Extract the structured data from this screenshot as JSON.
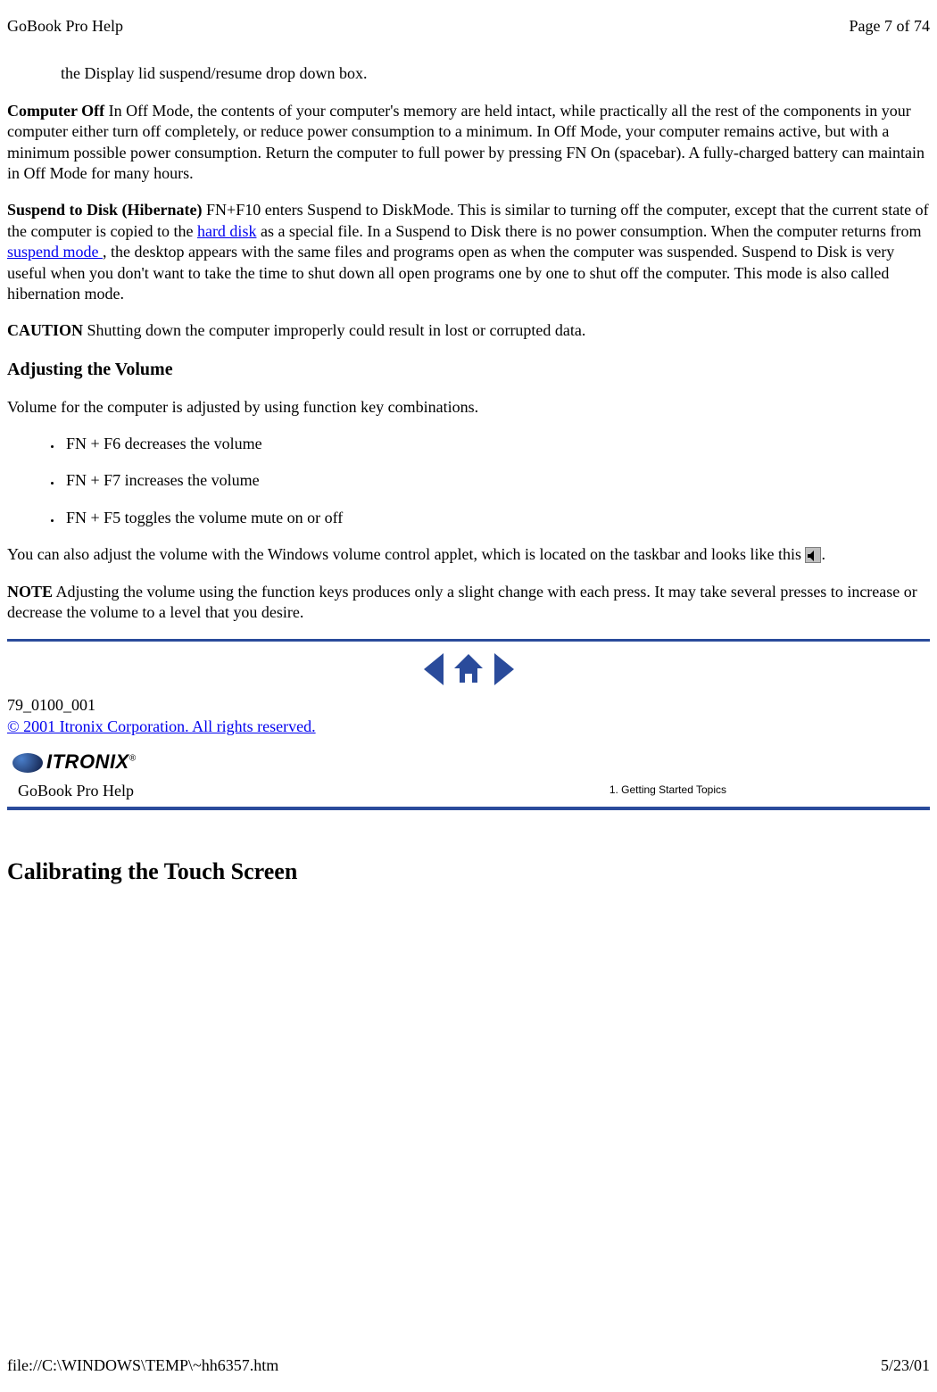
{
  "header": {
    "doc_title": "GoBook Pro Help",
    "page_label": "Page 7 of 74"
  },
  "content": {
    "continuation": "the Display lid suspend/resume drop down box.",
    "computer_off_label": "Computer Off ",
    "computer_off_text": "  In Off Mode, the contents of your computer's memory are held intact, while practically all the rest of the components in your computer either turn off completely, or reduce power consumption to a minimum.  In Off Mode, your computer remains active, but with a minimum possible power consumption.  Return the computer to full power by pressing FN On (spacebar).  A fully-charged battery can maintain in Off Mode for many hours.",
    "suspend_label": "Suspend to Disk (Hibernate)",
    "suspend_text_1": "  FN+F10 enters Suspend to DiskMode.  This  is similar to turning off the computer, except that the current state of the computer is copied to the ",
    "link_hard_disk": "hard disk",
    "suspend_text_2": " as a special file.  In a Suspend to Disk there is no power consumption. When the computer returns from ",
    "link_suspend_mode": "suspend mode ",
    "suspend_text_3": ", the desktop appears with the same files and programs open as when the computer was suspended.  Suspend to Disk is very useful when you don't want to take the time to shut down all open programs one by one to shut off the computer.  This mode is also called hibernation mode.",
    "caution_label": "CAUTION",
    "caution_text": "  Shutting down the computer improperly could result in lost or corrupted data.",
    "volume_heading": "Adjusting the Volume",
    "volume_intro": "Volume for the computer is adjusted by using function key combinations.",
    "bullets": [
      "FN + F6 decreases the volume",
      "FN + F7 increases the volume",
      "FN + F5  toggles the volume mute on or off"
    ],
    "applet_text_1": "You can also adjust the volume with the Windows volume control applet, which is located on the taskbar and looks like this ",
    "applet_text_2": ".",
    "note_label": "NOTE",
    "note_text": "  Adjusting the volume using the function keys produces only a slight change with each press.  It may take several presses to increase or decrease the volume to a level that you desire.",
    "doc_number": "79_0100_001",
    "copyright": "© 2001 Itronix Corporation.  All rights reserved.",
    "brand": "ITRONIX",
    "help_title": "GoBook Pro Help",
    "topic_label": "1. Getting Started Topics",
    "calibrating_heading": "Calibrating the Touch Screen"
  },
  "footer": {
    "path": "file://C:\\WINDOWS\\TEMP\\~hh6357.htm",
    "date": "5/23/01"
  }
}
